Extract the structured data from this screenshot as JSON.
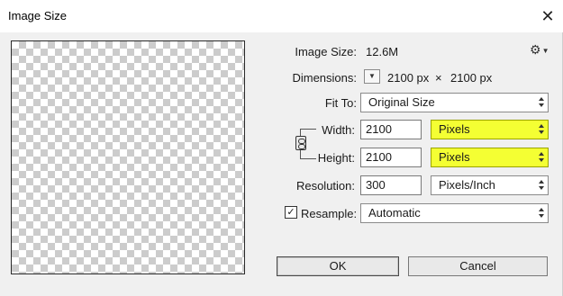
{
  "window": {
    "title": "Image Size"
  },
  "icons": {
    "close": "close-icon",
    "gear": "gear-icon",
    "link": "link-constrain-icon"
  },
  "info": {
    "image_size_label": "Image Size:",
    "image_size_value": "12.6M",
    "dimensions_label": "Dimensions:",
    "dimensions_width": "2100 px",
    "dimensions_times": "×",
    "dimensions_height": "2100 px"
  },
  "fit_to": {
    "label": "Fit To:",
    "selected": "Original Size"
  },
  "width": {
    "label": "Width:",
    "value": "2100",
    "unit": "Pixels"
  },
  "height": {
    "label": "Height:",
    "value": "2100",
    "unit": "Pixels"
  },
  "resolution": {
    "label": "Resolution:",
    "value": "300",
    "unit": "Pixels/Inch"
  },
  "resample": {
    "label": "Resample:",
    "checked": true,
    "check_glyph": "✓",
    "selected": "Automatic"
  },
  "buttons": {
    "ok": "OK",
    "cancel": "Cancel"
  },
  "colors": {
    "highlight": "#f4ff33",
    "dialog_bg": "#f0f0f0"
  }
}
